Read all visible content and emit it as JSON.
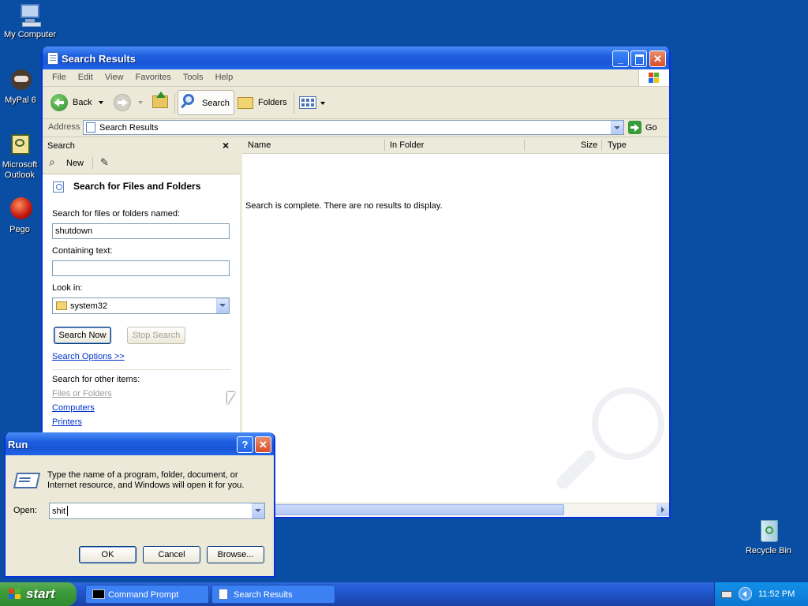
{
  "desktop": {
    "icons": [
      {
        "label": "My Computer"
      },
      {
        "label": "MyPal 6"
      },
      {
        "label": "Microsoft Outlook"
      },
      {
        "label": "Pego"
      },
      {
        "label": "Recycle Bin"
      }
    ]
  },
  "explorer": {
    "title": "Search Results",
    "menu": [
      "File",
      "Edit",
      "View",
      "Favorites",
      "Tools",
      "Help"
    ],
    "toolbar": {
      "back": "Back",
      "search": "Search",
      "folders": "Folders"
    },
    "address": {
      "label": "Address",
      "value": "Search Results",
      "go": "Go"
    },
    "search_pane": {
      "title": "Search",
      "new_label": "New",
      "heading": "Search for Files and Folders",
      "named_label": "Search for files or folders named:",
      "named_value": "shutdown",
      "containing_label": "Containing text:",
      "containing_value": "",
      "lookin_label": "Look in:",
      "lookin_value": "system32",
      "search_now": "Search Now",
      "stop_search": "Stop Search",
      "options": "Search Options >>",
      "other_label": "Search for other items:",
      "other_items": [
        "Files or Folders",
        "Computers",
        "Printers"
      ]
    },
    "results": {
      "columns": [
        "Name",
        "In Folder",
        "Size",
        "Type"
      ],
      "message": "Search is complete. There are no results to display."
    }
  },
  "run_dialog": {
    "title": "Run",
    "help": "?",
    "description_line1": "Type the name of a program, folder, document, or",
    "description_line2": "Internet resource, and Windows will open it for you.",
    "open_label": "Open:",
    "open_value": "shit",
    "ok": "OK",
    "cancel": "Cancel",
    "browse": "Browse..."
  },
  "taskbar": {
    "start": "start",
    "tasks": [
      "Command Prompt",
      "Search Results"
    ],
    "clock": "11:52 PM"
  }
}
